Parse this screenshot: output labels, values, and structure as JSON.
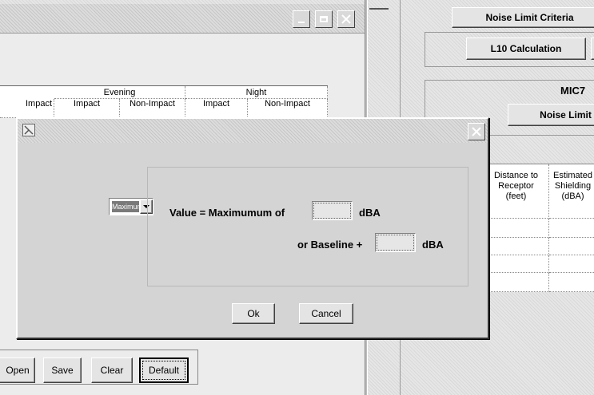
{
  "background_window": {
    "table_header": {
      "group_labels": [
        "Evening",
        "Night"
      ],
      "col_labels": [
        "Impact",
        "Impact",
        "Non-Impact",
        "Impact",
        "Non-Impact"
      ]
    },
    "buttons": {
      "open_label": "Open",
      "save_label": "Save",
      "clear_label": "Clear",
      "default_label": "Default"
    }
  },
  "right_panel": {
    "noise_limit_criteria_label": "Noise Limit Criteria",
    "l10_calculation_label": "L10 Calculation",
    "site_label": "MIC7",
    "noise_limit_label": "Noise Limit",
    "table_headers": {
      "distance": "Distance to Receptor (feet)",
      "shielding": "Estimated Shielding (dBA)"
    }
  },
  "dialog": {
    "mode_select_value": "Maximum",
    "value_label": "Value = Maximumum of",
    "value_input": "",
    "unit1": "dBA",
    "baseline_label": "or Baseline +",
    "baseline_input": "",
    "unit2": "dBA",
    "ok_label": "Ok",
    "cancel_label": "Cancel"
  },
  "colors": {
    "dialog_face": "#d4d4d4",
    "title_bar": "#c8c8c8",
    "select_highlight": "#e8e8e8"
  }
}
